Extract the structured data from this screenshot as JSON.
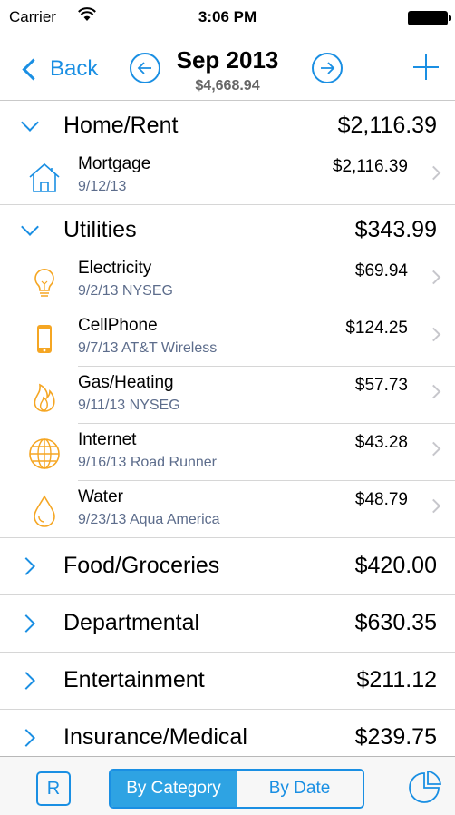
{
  "status_bar": {
    "carrier": "Carrier",
    "time": "3:06 PM"
  },
  "nav": {
    "back_label": "Back",
    "title": "Sep 2013",
    "subtitle": "$4,668.94"
  },
  "categories": [
    {
      "name": "Home/Rent",
      "amount": "$2,116.39",
      "items": [
        {
          "title": "Mortgage",
          "sub": "9/12/13",
          "amount": "$2,116.39",
          "icon": "house-icon"
        }
      ]
    },
    {
      "name": "Utilities",
      "amount": "$343.99",
      "items": [
        {
          "title": "Electricity",
          "sub": "9/2/13 NYSEG",
          "amount": "$69.94",
          "icon": "lightbulb-icon"
        },
        {
          "title": "CellPhone",
          "sub": "9/7/13 AT&T Wireless",
          "amount": "$124.25",
          "icon": "phone-icon"
        },
        {
          "title": "Gas/Heating",
          "sub": "9/11/13 NYSEG",
          "amount": "$57.73",
          "icon": "flame-icon"
        },
        {
          "title": "Internet",
          "sub": "9/16/13 Road Runner",
          "amount": "$43.28",
          "icon": "globe-icon"
        },
        {
          "title": "Water",
          "sub": "9/23/13 Aqua America",
          "amount": "$48.79",
          "icon": "water-drop-icon"
        }
      ]
    },
    {
      "name": "Food/Groceries",
      "amount": "$420.00"
    },
    {
      "name": "Departmental",
      "amount": "$630.35"
    },
    {
      "name": "Entertainment",
      "amount": "$211.12"
    },
    {
      "name": "Insurance/Medical",
      "amount": "$239.75"
    }
  ],
  "tabbar": {
    "r_label": "R",
    "segments": [
      "By Category",
      "By Date"
    ],
    "selected": "By Category"
  },
  "colors": {
    "accent": "#1a8fe3",
    "icon_orange": "#f5a623",
    "segment_active": "#2ea3e3"
  }
}
